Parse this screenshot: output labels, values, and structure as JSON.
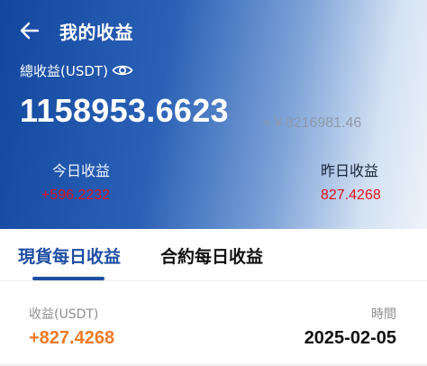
{
  "header": {
    "title": "我的收益",
    "total_label": "總收益(USDT)",
    "total_value": "1158953.6623",
    "total_approx": "≈￥8216981.46",
    "today_label": "今日收益",
    "today_value": "+596.2232",
    "yesterday_label": "昨日收益",
    "yesterday_value": "827.4268",
    "icons": {
      "back": "arrow-left-icon",
      "visibility": "eye-icon"
    }
  },
  "tabs": [
    {
      "label": "現貨每日收益",
      "active": true
    },
    {
      "label": "合約每日收益",
      "active": false
    }
  ],
  "records": {
    "col_income_label": "收益(USDT)",
    "col_time_label": "時間",
    "rows": [
      {
        "income": "+827.4268",
        "time": "2025-02-05"
      }
    ]
  },
  "colors": {
    "accent": "#1d4ea3",
    "positive_orange": "#f07a26",
    "red": "#e0121e"
  }
}
